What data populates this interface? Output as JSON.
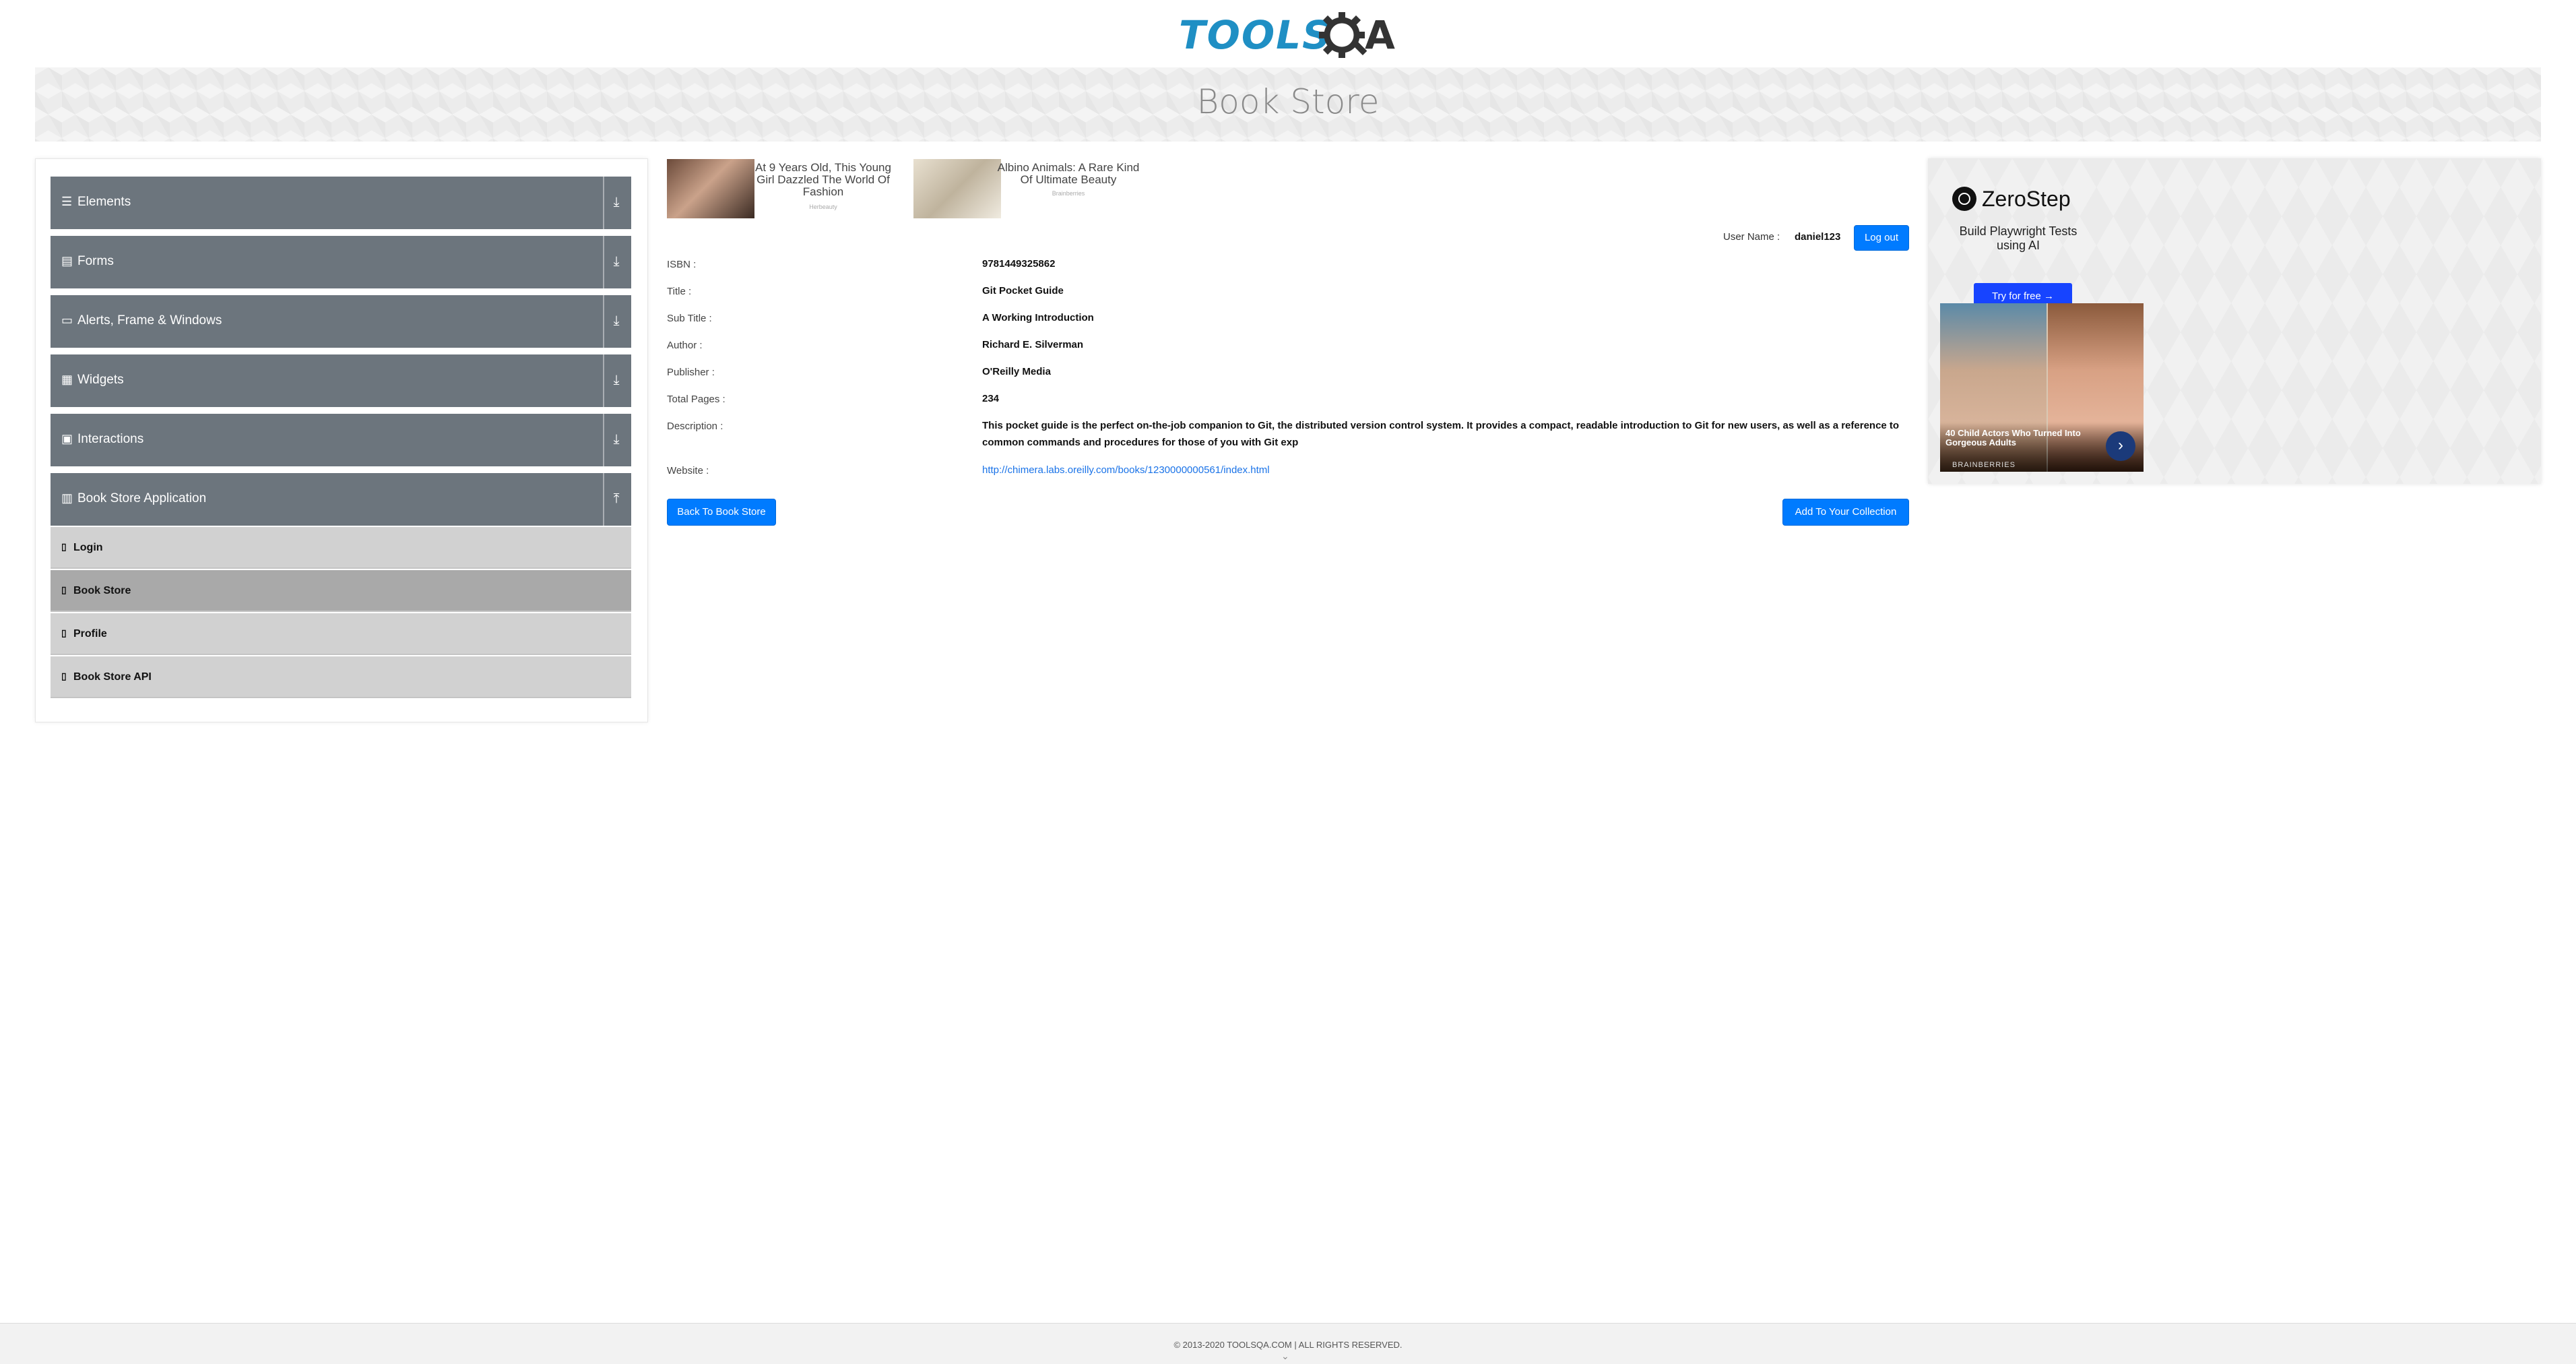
{
  "header": {
    "logo_text": "TOOLS",
    "logo_suffix": "A",
    "banner_title": "Book Store"
  },
  "sidebar": {
    "groups": [
      {
        "label": "Elements",
        "icon": "list-icon",
        "expanded": false
      },
      {
        "label": "Forms",
        "icon": "form-icon",
        "expanded": false
      },
      {
        "label": "Alerts, Frame & Windows",
        "icon": "window-icon",
        "expanded": false
      },
      {
        "label": "Widgets",
        "icon": "grid-icon",
        "expanded": false
      },
      {
        "label": "Interactions",
        "icon": "interaction-icon",
        "expanded": false
      },
      {
        "label": "Book Store Application",
        "icon": "book-icon",
        "expanded": true
      }
    ],
    "items": [
      {
        "label": "Login",
        "active": false
      },
      {
        "label": "Book Store",
        "active": true
      },
      {
        "label": "Profile",
        "active": false
      },
      {
        "label": "Book Store API",
        "active": false
      }
    ]
  },
  "ads": {
    "ad1": {
      "title": "At 9 Years Old, This Young Girl Dazzled The World Of Fashion",
      "source": "Herbeauty"
    },
    "ad2": {
      "title": "Albino Animals: A Rare Kind Of Ultimate Beauty",
      "source": "Brainberries"
    }
  },
  "user": {
    "label": "User Name :",
    "value": "daniel123",
    "logout_label": "Log out"
  },
  "book": {
    "isbn_label": "ISBN :",
    "isbn": "9781449325862",
    "title_label": "Title :",
    "title": "Git Pocket Guide",
    "subtitle_label": "Sub Title :",
    "subtitle": "A Working Introduction",
    "author_label": "Author :",
    "author": "Richard E. Silverman",
    "publisher_label": "Publisher :",
    "publisher": "O'Reilly Media",
    "pages_label": "Total Pages :",
    "pages": "234",
    "description_label": "Description :",
    "description": "This pocket guide is the perfect on-the-job companion to Git, the distributed version control system. It provides a compact, readable introduction to Git for new users, as well as a reference to common commands and procedures for those of you with Git exp",
    "website_label": "Website :",
    "website": "http://chimera.labs.oreilly.com/books/1230000000561/index.html"
  },
  "actions": {
    "back_label": "Back To Book Store",
    "add_label": "Add To Your Collection"
  },
  "right_ad": {
    "brand": "ZeroStep",
    "tagline": "Build Playwright Tests using AI",
    "cta": "Try for free →",
    "caption": "40 Child Actors Who Turned Into Gorgeous Adults",
    "source": "BRAINBERRIES"
  },
  "footer": {
    "text": "© 2013-2020 TOOLSQA.COM | ALL RIGHTS RESERVED."
  },
  "colors": {
    "primary": "#007bff",
    "group_bg": "#6c757d",
    "item_bg": "#d1d1d1",
    "item_active_bg": "#a9a9a9",
    "logo_blue": "#1f8fc4"
  }
}
